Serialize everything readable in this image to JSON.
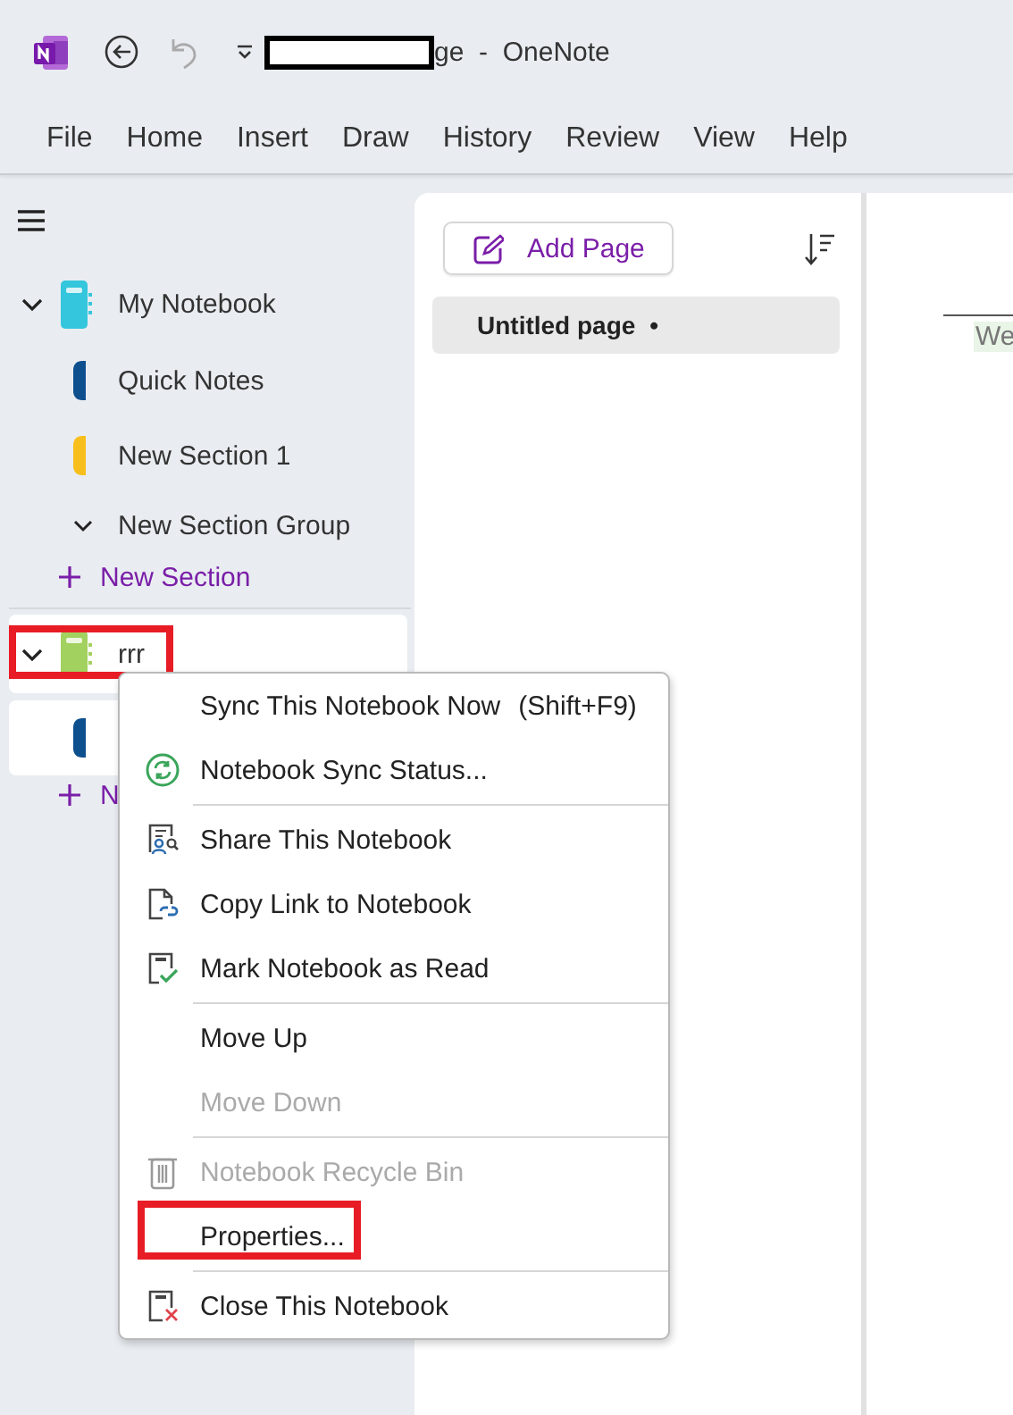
{
  "window": {
    "title": "ge  -  OneNote",
    "undo": {
      "disabled": true
    }
  },
  "menu_tabs": [
    {
      "label": "File",
      "selected": false
    },
    {
      "label": "Home",
      "selected": false
    },
    {
      "label": "Insert",
      "selected": false
    },
    {
      "label": "Draw",
      "selected": false
    },
    {
      "label": "History",
      "selected": false
    },
    {
      "label": "Review",
      "selected": false
    },
    {
      "label": "View",
      "selected": false
    },
    {
      "label": "Help",
      "selected": false
    }
  ],
  "notebooks": [
    {
      "name": "My Notebook",
      "color": "#34c6dc",
      "expanded": true,
      "selected": false,
      "items": [
        {
          "kind": "section",
          "label": "Quick Notes",
          "color": "#0e4f8e",
          "selected": false
        },
        {
          "kind": "section",
          "label": "New Section 1",
          "color": "#f8bf1c",
          "selected": false
        },
        {
          "kind": "group",
          "label": "New Section Group",
          "expanded": true
        },
        {
          "kind": "add",
          "label": "New Section"
        }
      ]
    },
    {
      "name": "rrr",
      "color": "#a3d15f",
      "expanded": true,
      "selected": true,
      "marked": true,
      "items": [
        {
          "kind": "section",
          "color": "#0e4f8e",
          "selected": true
        },
        {
          "kind": "add",
          "label": "N"
        }
      ]
    }
  ],
  "page_list": {
    "add_page": "Add Page",
    "pages": [
      {
        "title": "Untitled page",
        "marker": "•",
        "selected": true
      }
    ]
  },
  "canvas": {
    "text": "We"
  },
  "context_menu": {
    "items": [
      {
        "kind": "item",
        "label": "Sync This Notebook Now",
        "shortcut": "(Shift+F9)",
        "disabled": false
      },
      {
        "kind": "item",
        "label": "Notebook Sync Status...",
        "disabled": false
      },
      {
        "kind": "separator"
      },
      {
        "kind": "item",
        "label": "Share This Notebook",
        "disabled": false
      },
      {
        "kind": "item",
        "label": "Copy Link to Notebook",
        "disabled": false
      },
      {
        "kind": "item",
        "label": "Mark Notebook as Read",
        "disabled": false
      },
      {
        "kind": "separator"
      },
      {
        "kind": "item",
        "label": "Move Up",
        "disabled": false
      },
      {
        "kind": "item",
        "label": "Move Down",
        "disabled": true
      },
      {
        "kind": "separator"
      },
      {
        "kind": "item",
        "label": "Notebook Recycle Bin",
        "disabled": true
      },
      {
        "kind": "item",
        "label": "Properties...",
        "disabled": false,
        "marked": true
      },
      {
        "kind": "separator"
      },
      {
        "kind": "item",
        "label": "Close This Notebook",
        "disabled": false
      }
    ]
  }
}
